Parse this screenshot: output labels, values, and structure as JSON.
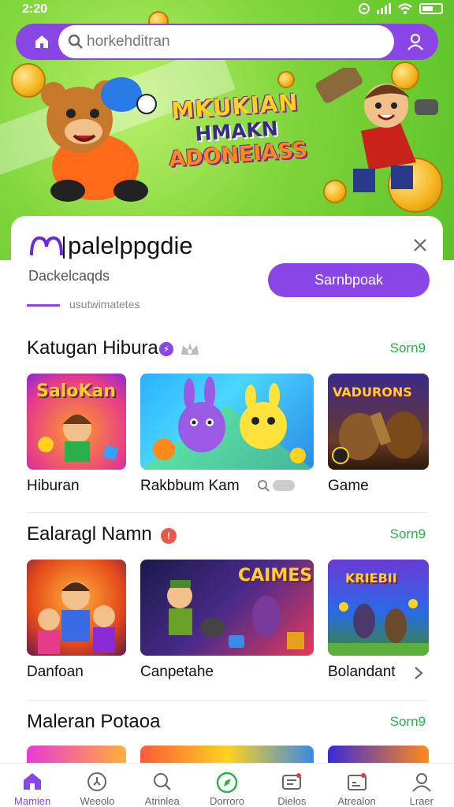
{
  "status_bar": {
    "time": "2:20"
  },
  "search": {
    "placeholder": "horkehditran"
  },
  "hero": {
    "line1": "MKUKIAN",
    "line2": "HMAKN",
    "line3": "ADONEIASS"
  },
  "card": {
    "brand_name": "palelppgdie",
    "subtitle": "Dackelcaqds",
    "action_button": "Sarnbpoak",
    "tab_label": "usutwimatetes"
  },
  "sections": [
    {
      "title": "Katugan Hibura",
      "more": "Sorn9",
      "tiles": [
        {
          "name": "Hiburan",
          "art_text": "SaloKan"
        },
        {
          "name": "Rakbbum Kam",
          "art_text": ""
        },
        {
          "name": "Game",
          "art_text": "VADURONS"
        }
      ]
    },
    {
      "title": "Ealaragl Namn",
      "more": "Sorn9",
      "tiles": [
        {
          "name": "Danfoan",
          "art_text": ""
        },
        {
          "name": "Canpetahe",
          "art_text": "CAIMES"
        },
        {
          "name": "Bolandant",
          "art_text": "KRIEBII"
        }
      ]
    },
    {
      "title": "Maleran Potaoa",
      "more": "Sorn9"
    }
  ],
  "bottom_nav": [
    {
      "label": "Mamien",
      "icon": "home-icon"
    },
    {
      "label": "Weeolo",
      "icon": "clock-icon"
    },
    {
      "label": "Atrinlea",
      "icon": "search-icon"
    },
    {
      "label": "Dorroro",
      "icon": "compass-icon"
    },
    {
      "label": "Dielos",
      "icon": "ticket-icon"
    },
    {
      "label": "Atrealon",
      "icon": "inbox-icon"
    },
    {
      "label": "Lraer",
      "icon": "user-icon"
    }
  ],
  "colors": {
    "accent": "#8a45e6",
    "link_green": "#2ab04a",
    "banner_green": "#7fd53a"
  }
}
